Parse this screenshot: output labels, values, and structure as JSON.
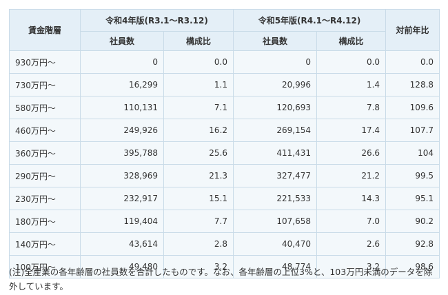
{
  "table": {
    "header": {
      "band": "賃金階層",
      "year1": "令和4年版(R3.1〜R3.12)",
      "year2": "令和5年版(R4.1〜R4.12)",
      "yoy": "対前年比",
      "employees": "社員数",
      "ratio": "構成比"
    },
    "rows": [
      {
        "band": "930万円〜",
        "emp1": "0",
        "ratio1": "0.0",
        "emp2": "0",
        "ratio2": "0.0",
        "yoy": "0.0"
      },
      {
        "band": "730万円〜",
        "emp1": "16,299",
        "ratio1": "1.1",
        "emp2": "20,996",
        "ratio2": "1.4",
        "yoy": "128.8"
      },
      {
        "band": "580万円〜",
        "emp1": "110,131",
        "ratio1": "7.1",
        "emp2": "120,693",
        "ratio2": "7.8",
        "yoy": "109.6"
      },
      {
        "band": "460万円〜",
        "emp1": "249,926",
        "ratio1": "16.2",
        "emp2": "269,154",
        "ratio2": "17.4",
        "yoy": "107.7"
      },
      {
        "band": "360万円〜",
        "emp1": "395,788",
        "ratio1": "25.6",
        "emp2": "411,431",
        "ratio2": "26.6",
        "yoy": "104"
      },
      {
        "band": "290万円〜",
        "emp1": "328,969",
        "ratio1": "21.3",
        "emp2": "327,477",
        "ratio2": "21.2",
        "yoy": "99.5"
      },
      {
        "band": "230万円〜",
        "emp1": "232,917",
        "ratio1": "15.1",
        "emp2": "221,533",
        "ratio2": "14.3",
        "yoy": "95.1"
      },
      {
        "band": "180万円〜",
        "emp1": "119,404",
        "ratio1": "7.7",
        "emp2": "107,658",
        "ratio2": "7.0",
        "yoy": "90.2"
      },
      {
        "band": "140万円〜",
        "emp1": "43,614",
        "ratio1": "2.8",
        "emp2": "40,470",
        "ratio2": "2.6",
        "yoy": "92.8"
      },
      {
        "band": "100万円〜",
        "emp1": "49,480",
        "ratio1": "3.2",
        "emp2": "48,774",
        "ratio2": "3.2",
        "yoy": "98.6"
      }
    ]
  },
  "note": "(注)全産業の各年齢層の社員数を合計したものです。なお、各年齢層の上位3%と、103万円未満のデータを除外しています。",
  "colors": {
    "header_bg": "#e4eff7",
    "cell_bg": "#f3f8fb",
    "border": "#c9dbe8"
  }
}
